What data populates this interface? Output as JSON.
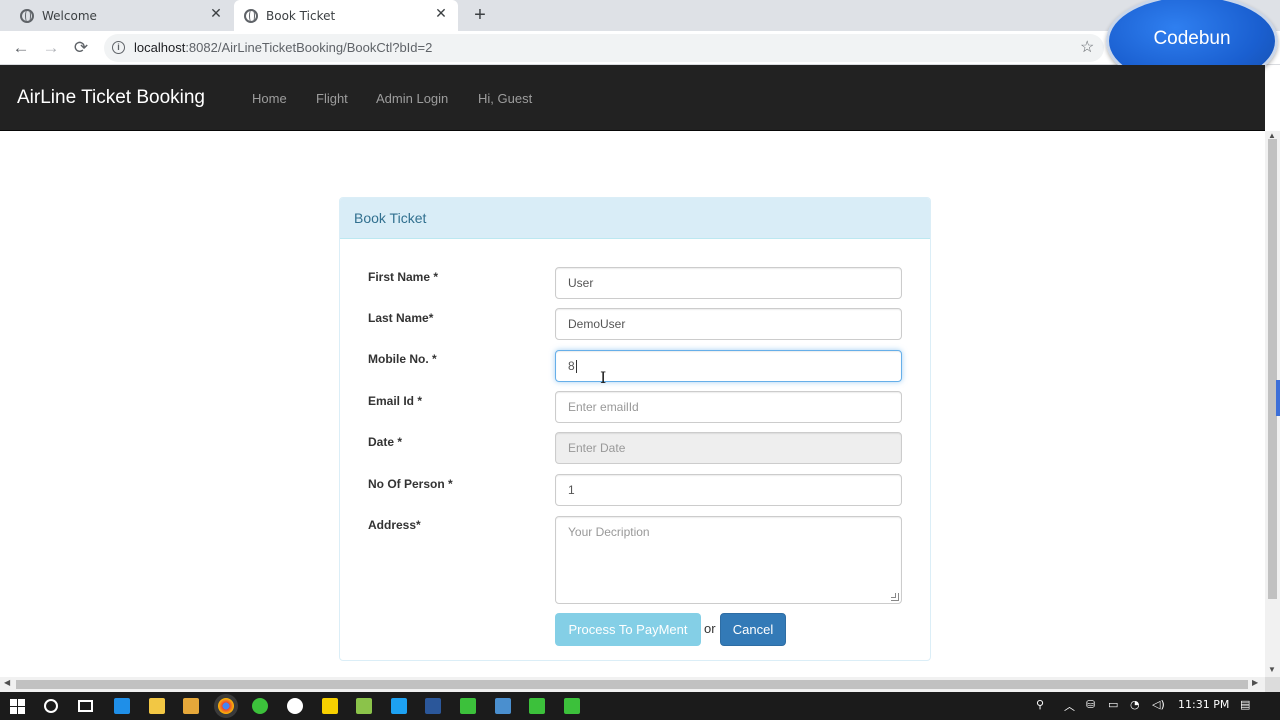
{
  "browser": {
    "tabs": [
      {
        "title": "Welcome",
        "close": "✕"
      },
      {
        "title": "Book Ticket",
        "close": "✕"
      }
    ],
    "new_tab": "+",
    "url_host": "localhost",
    "url_rest": ":8082/AirLineTicketBooking/BookCtl?bId=2",
    "nav": {
      "back": "←",
      "forward": "→",
      "reload": "⟳",
      "star": "☆",
      "info": "i"
    }
  },
  "badge": {
    "label": "Codebun"
  },
  "navbar": {
    "brand": "AirLine Ticket Booking",
    "links": [
      "Home",
      "Flight",
      "Admin Login",
      "Hi, Guest"
    ]
  },
  "panel": {
    "heading": "Book Ticket",
    "fields": {
      "first_name": {
        "label": "First Name *",
        "value": "User"
      },
      "last_name": {
        "label": "Last Name*",
        "value": "DemoUser"
      },
      "mobile": {
        "label": "Mobile No. *",
        "value": "8"
      },
      "email": {
        "label": "Email Id *",
        "placeholder": "Enter emailId"
      },
      "date": {
        "label": "Date *",
        "placeholder": "Enter Date"
      },
      "persons": {
        "label": "No Of Person *",
        "value": "1"
      },
      "address": {
        "label": "Address*",
        "placeholder": "Your Decription"
      }
    },
    "pay_button": "Process To PayMent",
    "or_text": "or",
    "cancel_button": "Cancel"
  },
  "taskbar": {
    "time": "11:31 PM",
    "icon_colors": [
      "#1f8fe8",
      "#f2c744",
      "#e6a83a",
      "#f25b2a",
      "#3cc13b",
      "#ffffff",
      "#f7d000",
      "#8bc34a",
      "#1da1f2",
      "#2b579a",
      "#3cc13b",
      "#4a8fcf",
      "#3cc13b",
      "#3cc13b"
    ]
  }
}
